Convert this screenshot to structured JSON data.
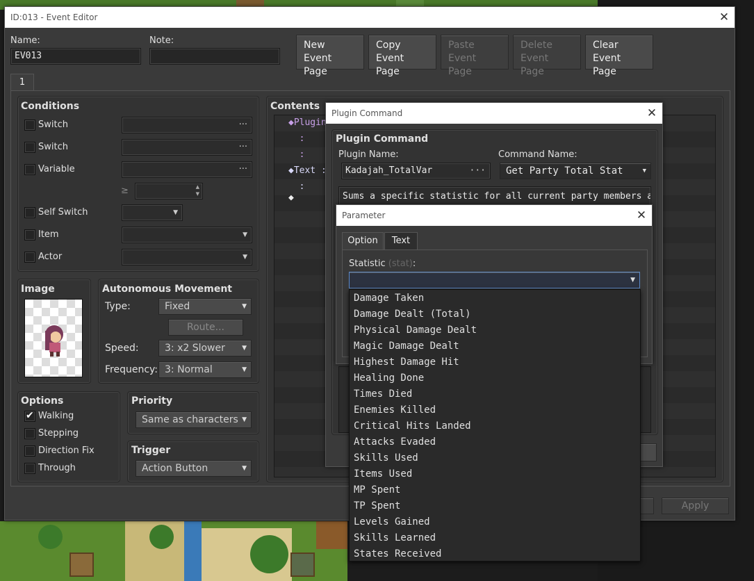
{
  "event_editor": {
    "title": "ID:013 - Event Editor",
    "name_label": "Name:",
    "name_value": "EV013",
    "note_label": "Note:",
    "note_value": "",
    "buttons": [
      {
        "line1": "New",
        "line2": "Event Page",
        "enabled": true
      },
      {
        "line1": "Copy",
        "line2": "Event Page",
        "enabled": true
      },
      {
        "line1": "Paste",
        "line2": "Event Page",
        "enabled": false
      },
      {
        "line1": "Delete",
        "line2": "Event Page",
        "enabled": false
      },
      {
        "line1": "Clear",
        "line2": "Event Page",
        "enabled": true
      }
    ],
    "page_tab": "1",
    "conditions": {
      "title": "Conditions",
      "switch1": "Switch",
      "switch2": "Switch",
      "variable": "Variable",
      "gte": "≥",
      "self_switch": "Self Switch",
      "item": "Item",
      "actor": "Actor"
    },
    "image": {
      "title": "Image"
    },
    "autonomous": {
      "title": "Autonomous Movement",
      "type_label": "Type:",
      "type_value": "Fixed",
      "route_button": "Route...",
      "speed_label": "Speed:",
      "speed_value": "3: x2 Slower",
      "frequency_label": "Frequency:",
      "frequency_value": "3: Normal"
    },
    "options": {
      "title": "Options",
      "walking": "Walking",
      "walking_checked": true,
      "stepping": "Stepping",
      "direction_fix": "Direction Fix",
      "through": "Through"
    },
    "priority": {
      "title": "Priority",
      "value": "Same as characters"
    },
    "trigger": {
      "title": "Trigger",
      "value": "Action Button"
    },
    "contents": {
      "title": "Contents",
      "lines": [
        "◆Plugin",
        "  :",
        "  :",
        "◆Text :",
        "  :    :",
        "◆"
      ]
    },
    "apply_button": "Apply"
  },
  "plugin_command": {
    "title": "Plugin Command",
    "group_title": "Plugin Command",
    "plugin_name_label": "Plugin Name:",
    "plugin_name_value": "Kadajah_TotalVar",
    "command_name_label": "Command Name:",
    "command_name_value": "Get Party Total Stat",
    "description": "Sums a specific statistic for all current party members and"
  },
  "parameter": {
    "title": "Parameter",
    "tabs": [
      "Option",
      "Text"
    ],
    "statistic_label": "Statistic",
    "statistic_key": "(stat)",
    "statistic_colon": ":",
    "statistic_value": "",
    "options": [
      "Damage Taken",
      "Damage Dealt (Total)",
      "Physical Damage Dealt",
      "Magic Damage Dealt",
      "Highest Damage Hit",
      "Healing Done",
      "Times Died",
      "Enemies Killed",
      "Critical Hits Landed",
      "Attacks Evaded",
      "Skills Used",
      "Items Used",
      "MP Spent",
      "TP Spent",
      "Levels Gained",
      "Skills Learned",
      "States Received"
    ]
  },
  "icons": {
    "close": "close-icon",
    "dropdown": "chevron-down-icon",
    "ellipsis": "ellipsis-icon",
    "diamond": "diamond-icon"
  },
  "colors": {
    "accent": "#5a88c8",
    "window": "#3a3a3a",
    "titlebar": "#ffffff"
  }
}
